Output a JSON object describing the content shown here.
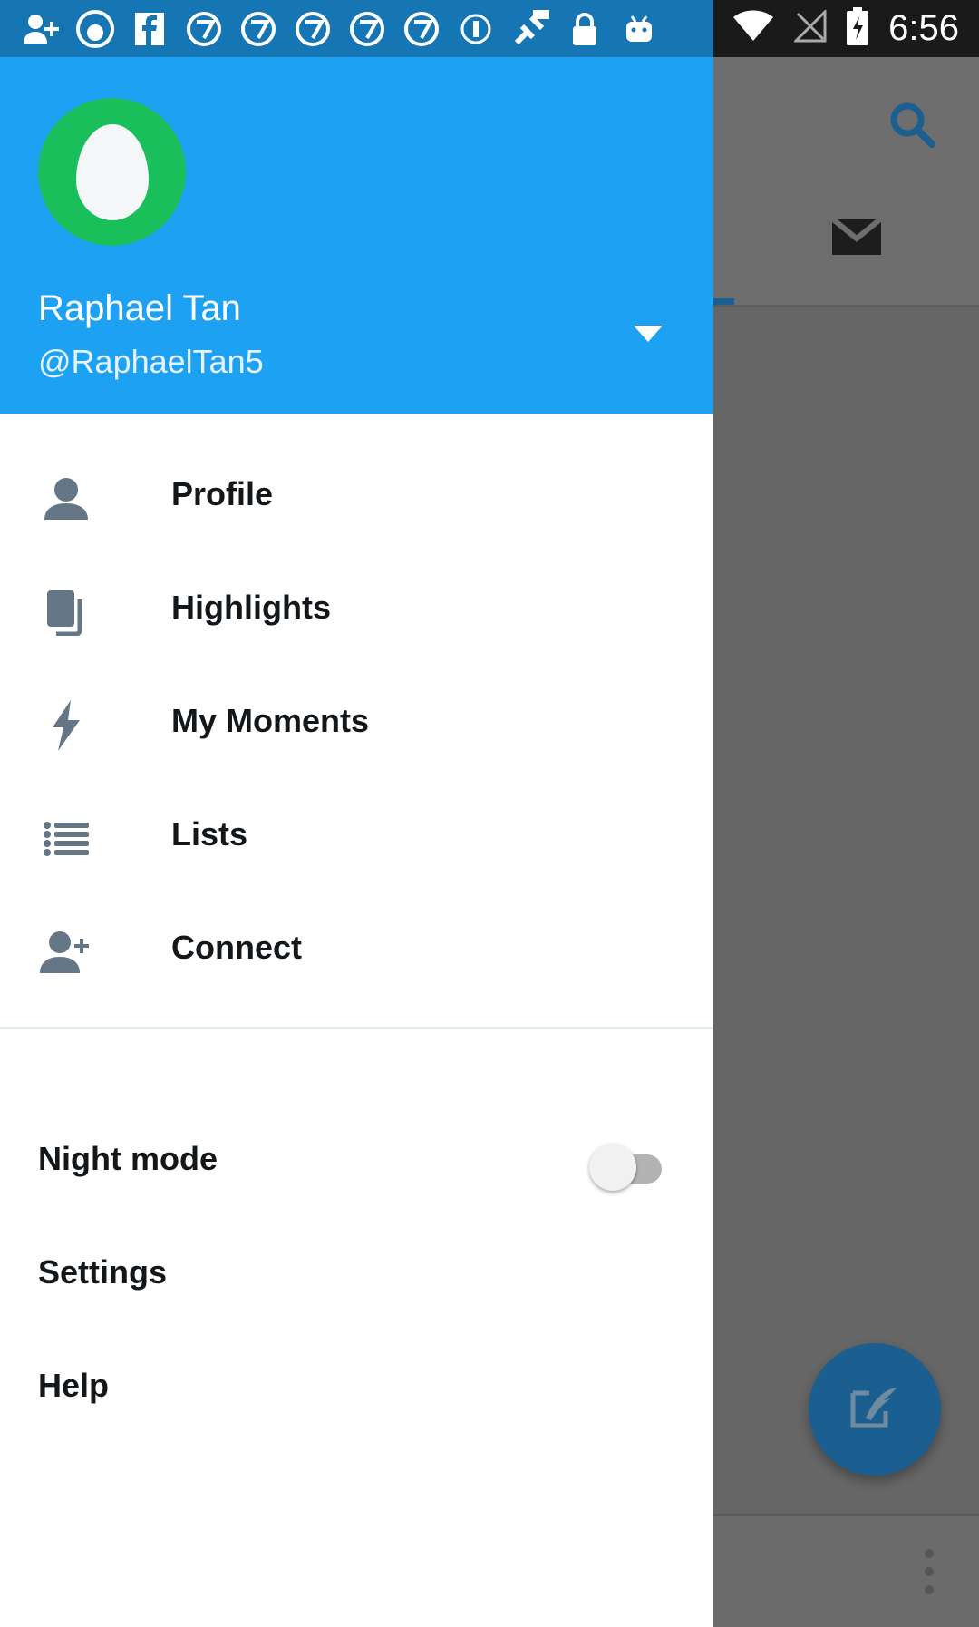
{
  "status_bar": {
    "time": "6:56",
    "icons": [
      "add-person-icon",
      "abc-news-icon",
      "facebook-icon",
      "abc7-icon",
      "abc7-icon",
      "abc7-icon",
      "abc7-icon",
      "abc7-icon",
      "info-circle-icon",
      "fake-gps-icon",
      "lock-icon",
      "android-icon"
    ],
    "right_icons": [
      "wifi-icon",
      "no-signal-icon",
      "battery-charging-icon"
    ]
  },
  "drawer": {
    "user": {
      "display_name": "Raphael Tan",
      "handle": "@RaphaelTan5",
      "avatar_color": "#19bf5b"
    },
    "menu_items": [
      {
        "label": "Profile",
        "icon": "profile-icon"
      },
      {
        "label": "Highlights",
        "icon": "highlights-icon"
      },
      {
        "label": "My Moments",
        "icon": "lightning-icon"
      },
      {
        "label": "Lists",
        "icon": "list-icon"
      },
      {
        "label": "Connect",
        "icon": "add-person-icon"
      }
    ],
    "night_mode": {
      "label": "Night mode",
      "enabled": false
    },
    "settings_label": "Settings",
    "help_label": "Help"
  },
  "colors": {
    "header_blue": "#1da1f2",
    "icon_gray": "#657786",
    "text_dark": "#14171a",
    "fab_blue": "#1a5f8f"
  }
}
